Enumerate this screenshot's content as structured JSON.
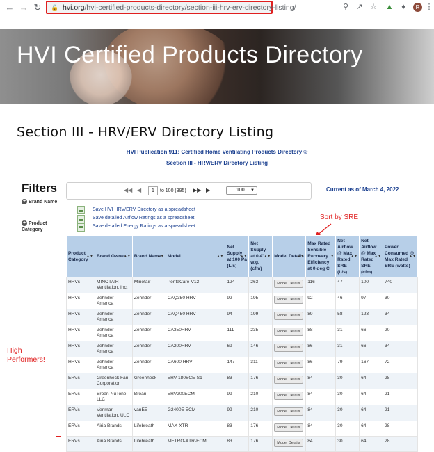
{
  "browser": {
    "url_host": "hvi.org",
    "url_path": "/hvi-certified-products-directory/section-iii-hrv-erv-directory-listing/",
    "avatar_letter": "R"
  },
  "banner": {
    "title": "HVI Certified Products Directory"
  },
  "page": {
    "section_title": "Section III - HRV/ERV Directory Listing",
    "publication_link": "HVI Publication 911: Certified Home Ventilating Products Directory ©",
    "section_link": "Section III - HRV/ERV Directory Listing",
    "current_as_of": "Current as of March 4, 2022"
  },
  "filters": {
    "title": "Filters",
    "items": [
      "Brand Name",
      "Product Category"
    ]
  },
  "pager": {
    "page": "1",
    "range_text": "to 100 (395)",
    "page_size": "100"
  },
  "downloads": [
    "Save HVI HRV/ERV Directory as a spreadsheet",
    "Save detailed Airflow Ratings as a spreadsheet",
    "Save detailed Energy Ratings as a spreadsheet"
  ],
  "annotations": {
    "sort_note": "Sort by SRE",
    "high_performers": "High Performers!",
    "accent_color": "#e02020"
  },
  "table": {
    "columns": [
      "Product Category",
      "Brand Owner",
      "Brand Name",
      "Model",
      "Net Supply at 100 Pa (L/s)",
      "Net Supply at 0.4\" w.g. (cfm)",
      "Model Details",
      "Max Rated Sensible Recovery Efficiency at 0 deg C",
      "Net Airflow @ Max Rated SRE (L/s)",
      "Net Airflow @ Max Rated SRE (cfm)",
      "Power Consumed @ Max Rated SRE (watts)"
    ],
    "details_label": "Model Details",
    "rows": [
      [
        "HRVs",
        "MINOTAIR Ventilation, Inc.",
        "Minotair",
        "PentaCare-V12",
        "124",
        "263",
        "116",
        "47",
        "100",
        "740"
      ],
      [
        "HRVs",
        "Zehnder America",
        "Zehnder",
        "CAQ350 HRV",
        "92",
        "195",
        "92",
        "46",
        "97",
        "30"
      ],
      [
        "HRVs",
        "Zehnder America",
        "Zehnder",
        "CAQ450 HRV",
        "94",
        "199",
        "89",
        "58",
        "123",
        "34"
      ],
      [
        "HRVs",
        "Zehnder America",
        "Zehnder",
        "CA350HRV",
        "111",
        "235",
        "88",
        "31",
        "66",
        "20"
      ],
      [
        "HRVs",
        "Zehnder America",
        "Zehnder",
        "CA200HRV",
        "69",
        "146",
        "86",
        "31",
        "66",
        "34"
      ],
      [
        "HRVs",
        "Zehnder America",
        "Zehnder",
        "CA600 HRV",
        "147",
        "311",
        "86",
        "79",
        "167",
        "72"
      ],
      [
        "ERVs",
        "Greenheck Fan Corporation",
        "Greenheck",
        "ERV-180SCE-S1",
        "83",
        "176",
        "84",
        "30",
        "64",
        "28"
      ],
      [
        "ERVs",
        "Broan-NuTone, LLC",
        "Broan",
        "ERV200ECM",
        "99",
        "210",
        "84",
        "30",
        "64",
        "21"
      ],
      [
        "ERVs",
        "Venmar Ventilation, ULC",
        "vanEE",
        "G2400E ECM",
        "99",
        "210",
        "84",
        "30",
        "64",
        "21"
      ],
      [
        "ERVs",
        "Airia Brands",
        "Lifebreath",
        "MAX-XTR",
        "83",
        "176",
        "84",
        "30",
        "64",
        "28"
      ],
      [
        "ERVs",
        "Airia Brands",
        "Lifebreath",
        "METRO-XTR-ECM",
        "83",
        "176",
        "84",
        "30",
        "64",
        "28"
      ]
    ]
  }
}
